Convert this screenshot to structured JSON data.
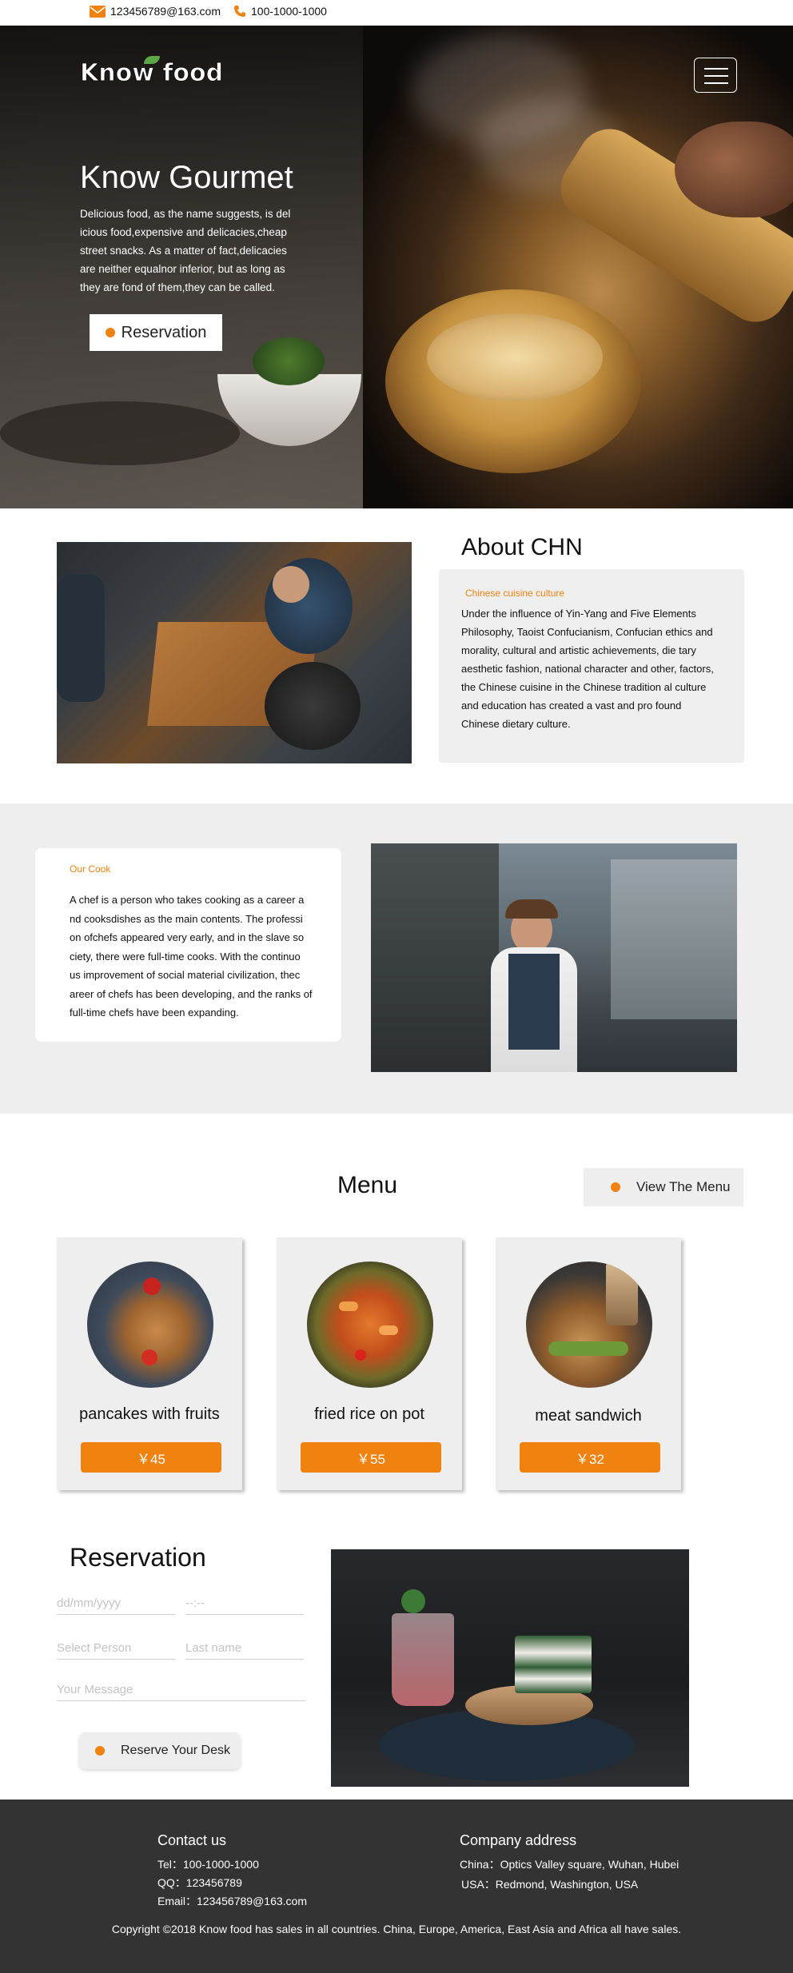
{
  "topbar": {
    "email": "123456789@163.com",
    "phone": "100-1000-1000",
    "email_icon": "envelope-icon",
    "phone_icon": "phone-icon"
  },
  "hero": {
    "logo": "Know food",
    "title": "Know Gourmet",
    "text": "Delicious food, as the name suggests, is del icious food,expensive and delicacies,cheap street snacks. As a matter of fact,delicacies are neither equalnor inferior, but as long as they are fond of them,they can be called.",
    "button": "Reservation",
    "menu_icon": "hamburger-menu-icon"
  },
  "about": {
    "title": "About CHN",
    "subtitle": "Chinese cuisine culture",
    "text": "Under the influence of Yin-Yang and Five Elements Philosophy, Taoist Confucianism, Confucian ethics and morality, cultural and artistic achievements, die tary aesthetic fashion, national character and other, factors, the Chinese cuisine in the Chinese tradition al culture and education has created a vast and pro found Chinese dietary culture."
  },
  "cook": {
    "subtitle": "Our Cook",
    "text": "A chef is a person who takes cooking as a career a nd cooksdishes as the main contents. The professi on ofchefs appeared very early, and in the slave so ciety, there were full-time cooks. With the continuo us improvement of social material civilization, thec areer of chefs has been developing, and the ranks of full-time chefs have been expanding."
  },
  "menu": {
    "title": "Menu",
    "view_button": "View The Menu",
    "items": [
      {
        "name": "pancakes with fruits",
        "price": "￥45"
      },
      {
        "name": "fried rice on pot",
        "price": "￥55"
      },
      {
        "name": "meat sandwich",
        "price": "￥32"
      }
    ]
  },
  "reservation": {
    "title": "Reservation",
    "date_placeholder": "dd/mm/yyyy",
    "time_placeholder": "--:--",
    "person_placeholder": "Select Person",
    "lastname_placeholder": "Last name",
    "message_placeholder": "Your Message",
    "button": "Reserve Your Desk"
  },
  "footer": {
    "contact_title": "Contact us",
    "tel": "Tel：100-1000-1000",
    "qq": "QQ：123456789",
    "email": "Email：123456789@163.com",
    "address_title": "Company address",
    "china": "China：Optics Valley square, Wuhan, Hubei",
    "usa": "USA：Redmond, Washington, USA",
    "copyright": "Copyright ©2018 Know food has sales in all countries. China, Europe, America, East Asia and Africa all have sales."
  },
  "colors": {
    "accent": "#f0820f",
    "footer_bg": "#333333",
    "panel_bg": "#eeeeee"
  }
}
